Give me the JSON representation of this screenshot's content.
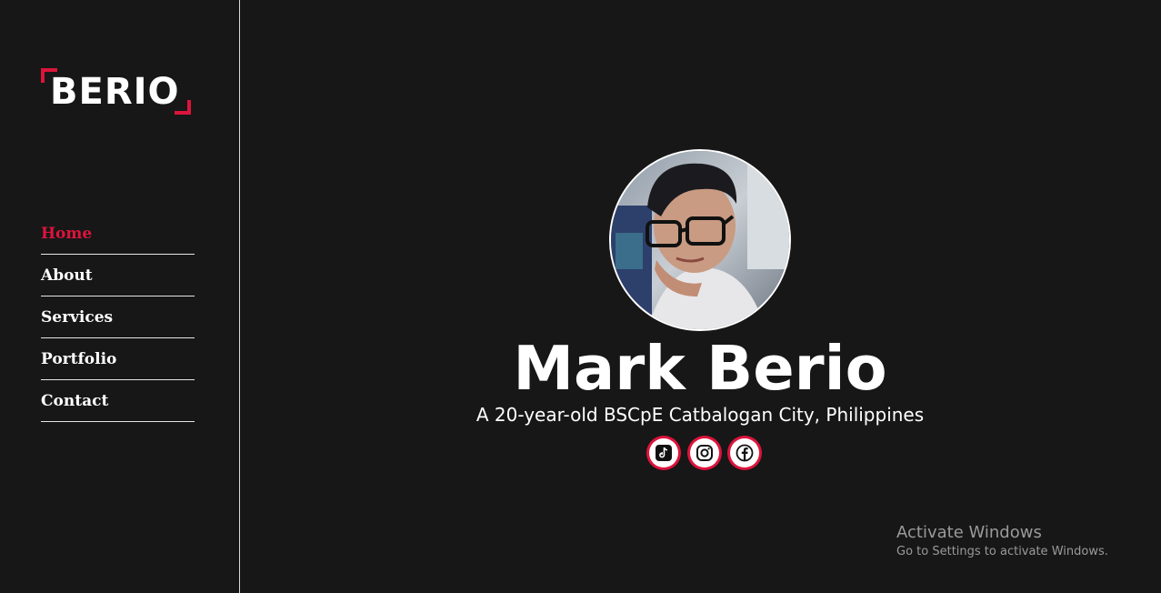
{
  "brand": {
    "logo": "BERIO"
  },
  "nav": {
    "items": [
      {
        "label": "Home",
        "active": true
      },
      {
        "label": "About",
        "active": false
      },
      {
        "label": "Services",
        "active": false
      },
      {
        "label": "Portfolio",
        "active": false
      },
      {
        "label": "Contact",
        "active": false
      }
    ]
  },
  "hero": {
    "name": "Mark Berio",
    "tagline": "A 20-year-old BSCpE Catbalogan City, Philippines",
    "socials": [
      "tiktok-icon",
      "instagram-icon",
      "facebook-icon"
    ]
  },
  "watermark": {
    "title": "Activate Windows",
    "subtitle": "Go to Settings to activate Windows."
  },
  "colors": {
    "background": "#171717",
    "accent": "#dc143c",
    "text": "#ffffff",
    "divider": "#e6e6e6"
  }
}
